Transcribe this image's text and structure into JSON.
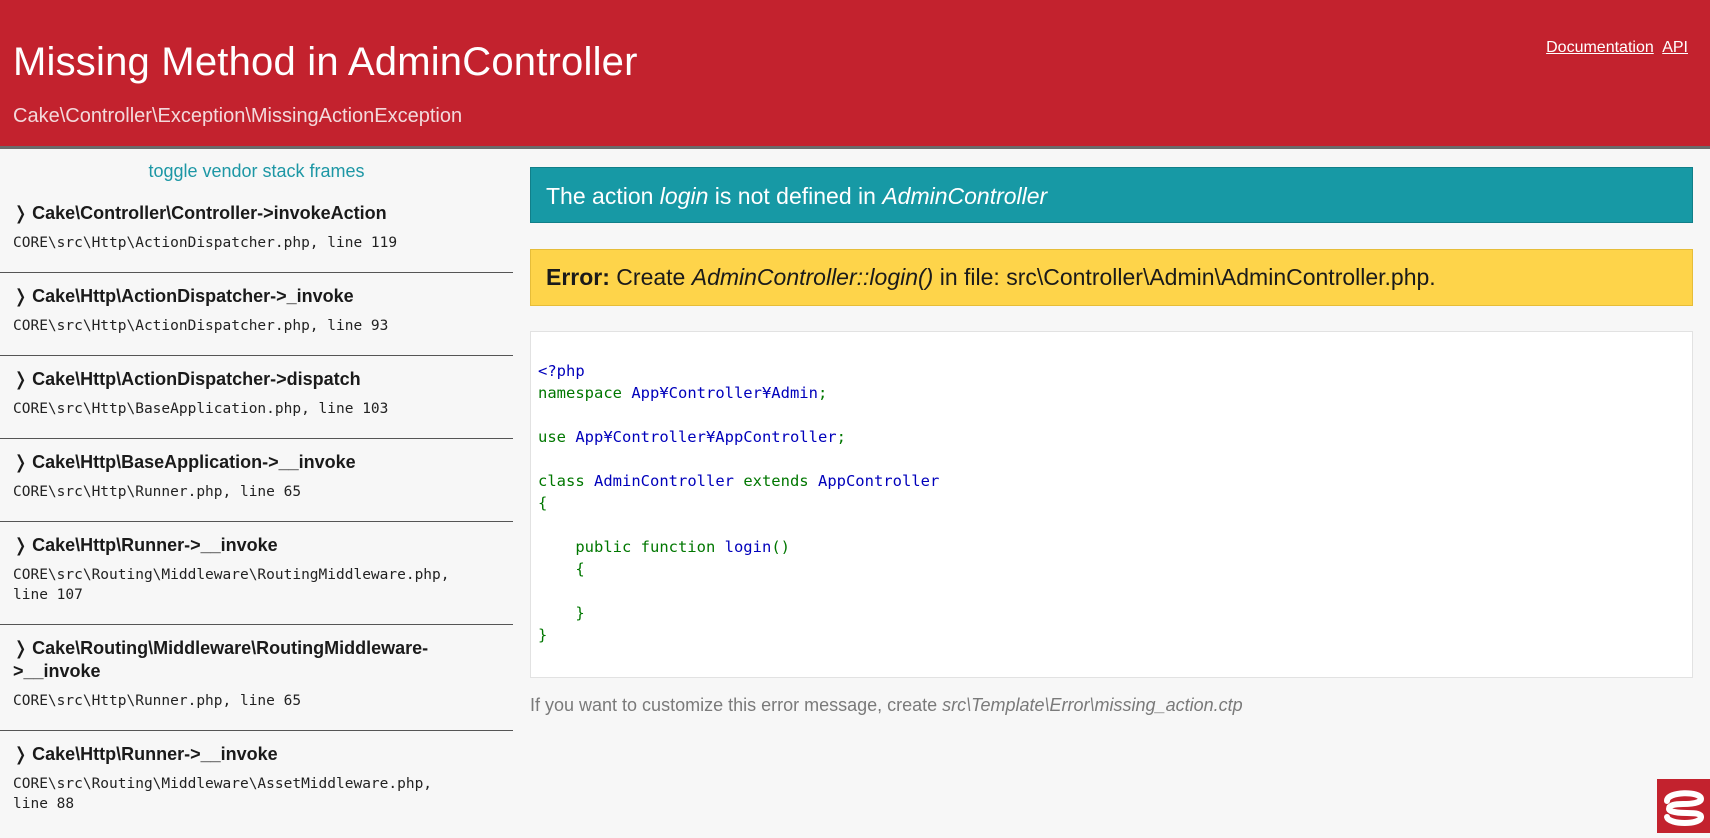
{
  "header": {
    "title": "Missing Method in AdminController",
    "subtitle": "Cake\\Controller\\Exception\\MissingActionException",
    "links": {
      "documentation": "Documentation",
      "api": "API"
    }
  },
  "sidebar": {
    "toggle_label": "toggle vendor stack frames",
    "frames": [
      {
        "arrow": "❭",
        "method": "Cake\\Controller\\Controller->invokeAction",
        "file": "CORE\\src\\Http\\ActionDispatcher.php, line 119"
      },
      {
        "arrow": "❭",
        "method": "Cake\\Http\\ActionDispatcher->_invoke",
        "file": "CORE\\src\\Http\\ActionDispatcher.php, line 93"
      },
      {
        "arrow": "❭",
        "method": "Cake\\Http\\ActionDispatcher->dispatch",
        "file": "CORE\\src\\Http\\BaseApplication.php, line 103"
      },
      {
        "arrow": "❭",
        "method": "Cake\\Http\\BaseApplication->__invoke",
        "file": "CORE\\src\\Http\\Runner.php, line 65"
      },
      {
        "arrow": "❭",
        "method": "Cake\\Http\\Runner->__invoke",
        "file": "CORE\\src\\Routing\\Middleware\\RoutingMiddleware.php,\nline 107"
      },
      {
        "arrow": "❭",
        "method": "Cake\\Routing\\Middleware\\RoutingMiddleware-\n>__invoke",
        "file": "CORE\\src\\Http\\Runner.php, line 65"
      },
      {
        "arrow": "❭",
        "method": "Cake\\Http\\Runner->__invoke",
        "file": "CORE\\src\\Routing\\Middleware\\AssetMiddleware.php,\nline 88"
      }
    ]
  },
  "main": {
    "info": {
      "prefix": "The action ",
      "action": "login",
      "middle": " is not defined in ",
      "controller": "AdminController"
    },
    "error": {
      "label": "Error:",
      "prefix": " Create ",
      "method": "AdminController::login()",
      "suffix": " in file: src\\Controller\\Admin\\AdminController.php."
    },
    "code": {
      "open_tag": "<?php",
      "namespace_kw": "namespace ",
      "namespace_val": "App¥Controller¥Admin",
      "use_kw": "use ",
      "use_val": "App¥Controller¥AppController",
      "semicolon": ";",
      "class_kw": "class ",
      "class_name": "AdminController",
      "extends_kw": " extends ",
      "parent_name": "AppController",
      "brace_open": "{",
      "brace_close": "}",
      "indent": "    ",
      "func_kw": "public function ",
      "func_name": "login",
      "parens": "()"
    },
    "footer": {
      "prefix": "If you want to customize this error message, create ",
      "path": "src\\Template\\Error\\missing_action.ctp"
    }
  },
  "colors": {
    "header_bg": "#c3222e",
    "info_bg": "#1799a5",
    "error_bg": "#fed44a",
    "toggle_link": "#1d97a5",
    "code_keyword": "#007700",
    "code_identifier": "#0000bb"
  },
  "icons": {
    "logo": "cakephp-logo-icon",
    "frame_arrow": "chevron-right-icon"
  }
}
